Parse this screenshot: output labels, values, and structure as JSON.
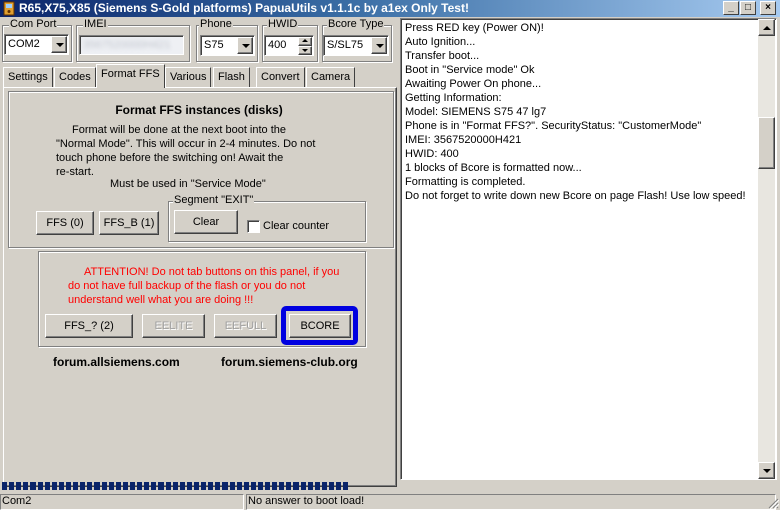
{
  "window": {
    "title": "R65,X75,X85 (Siemens S-Gold platforms) PapuaUtils v1.1.1c by a1ex Only Test!",
    "minimize": "_",
    "maximize": "□",
    "close": "×"
  },
  "top": {
    "com_port_label": "Com Port",
    "com_port_value": "COM2",
    "imei_label": "IMEI",
    "imei_value": "3567520000H421",
    "phone_label": "Phone",
    "phone_value": "S75",
    "hwid_label": "HWID",
    "hwid_value": "400",
    "bcore_type_label": "Bcore Type",
    "bcore_type_value": "S/SL75"
  },
  "tabs": [
    {
      "label": "Settings"
    },
    {
      "label": "Codes"
    },
    {
      "label": "Format FFS",
      "active": true
    },
    {
      "label": "Various"
    },
    {
      "label": "Flash"
    },
    {
      "label": "Convert"
    },
    {
      "label": "Camera"
    }
  ],
  "format_ffs": {
    "heading": "Format FFS instances (disks)",
    "desc": [
      "Format will be done at the next boot into the",
      "\"Normal Mode\". This will occur in 2-4 minutes. Do not",
      "touch phone before the switching on! Await the",
      "re-start."
    ],
    "service_note": "Must be used in \"Service Mode\"",
    "ffs_button": "FFS  (0)",
    "ffs_b_button": "FFS_B (1)",
    "segment_label": "Segment \"EXIT\"",
    "clear_button": "Clear",
    "clear_counter_label": "Clear counter",
    "clear_counter_checked": false
  },
  "attention": {
    "lines": [
      "ATTENTION! Do not tab buttons on this panel, if you",
      "do not have full backup of the flash or you do not",
      "understand well what you are doing !!!"
    ],
    "color": "#ff0000",
    "ffs_q_button": "FFS_? (2)",
    "eelite_button": "EELITE",
    "eefull_button": "EEFULL",
    "bcore_button": "BCORE",
    "highlight_color": "#0000e0"
  },
  "links": {
    "left": "forum.allsiemens.com",
    "right": "forum.siemens-club.org"
  },
  "log": [
    "Press RED key (Power ON)!",
    "Auto Ignition...",
    "Transfer boot...",
    "Boot in \"Service mode\" Ok",
    "Awaiting Power On phone...",
    "Getting Information:",
    "Model: SIEMENS S75 47 lg7",
    "Phone is in \"Format FFS?\". SecurityStatus: \"CustomerMode\"",
    "IMEI: 3567520000H421",
    "HWID: 400",
    "1 blocks of Bcore is formatted now...",
    "Formatting is completed.",
    "Do not forget to write down new Bcore on page Flash! Use low speed!"
  ],
  "status": {
    "port": "Com2",
    "message": "No answer to boot load!"
  },
  "progress": {
    "fraction": 1.0,
    "segments": 49
  },
  "colors": {
    "face": "#d4d0c8",
    "title_start": "#0a246a",
    "title_end": "#a6caf0",
    "progress": "#0a246a"
  }
}
